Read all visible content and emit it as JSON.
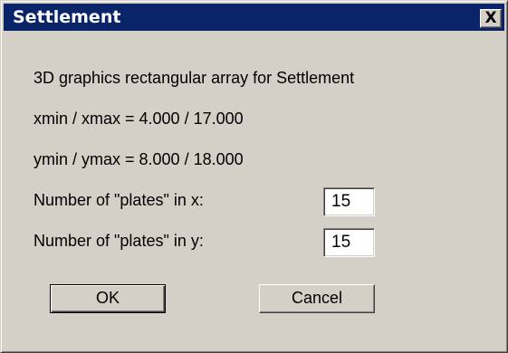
{
  "window": {
    "title": "Settlement",
    "close_glyph": "X",
    "titlebar_color": "#0a246a",
    "background_color": "#d4d0c8"
  },
  "content": {
    "description": "3D graphics rectangular array for Settlement",
    "x_range": "xmin / xmax =  4.000 / 17.000",
    "y_range": "ymin / ymax =  8.000 / 18.000"
  },
  "fields": {
    "plates_x_label": "Number of \"plates\" in x:",
    "plates_x_value": "15",
    "plates_y_label": "Number of \"plates\" in y:",
    "plates_y_value": "15"
  },
  "buttons": {
    "ok": "OK",
    "cancel": "Cancel"
  }
}
